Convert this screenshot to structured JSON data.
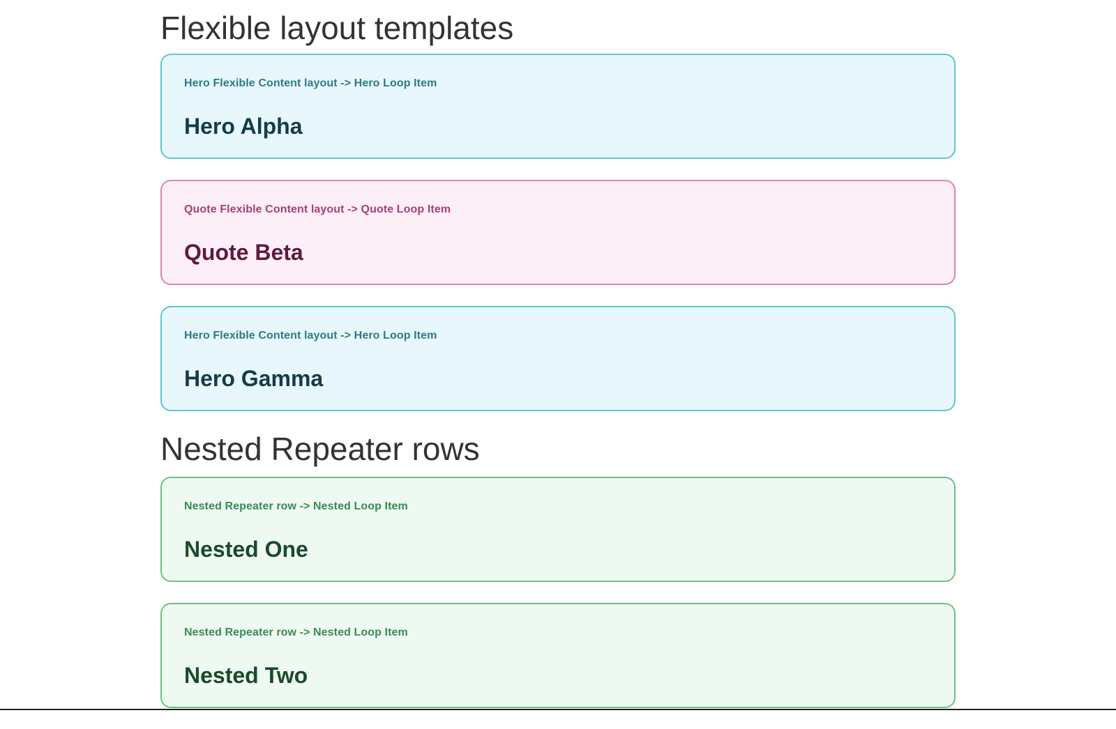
{
  "flexible": {
    "heading": "Flexible layout templates",
    "cards": [
      {
        "kicker": "Hero Flexible Content layout -> Hero Loop Item",
        "title": "Hero Alpha",
        "variant": "hero"
      },
      {
        "kicker": "Quote Flexible Content layout -> Quote Loop Item",
        "title": "Quote Beta",
        "variant": "quote"
      },
      {
        "kicker": "Hero Flexible Content layout -> Hero Loop Item",
        "title": "Hero Gamma",
        "variant": "hero"
      }
    ]
  },
  "nested": {
    "heading": "Nested Repeater rows",
    "cards": [
      {
        "kicker": "Nested Repeater row -> Nested Loop Item",
        "title": "Nested One",
        "variant": "nested"
      },
      {
        "kicker": "Nested Repeater row -> Nested Loop Item",
        "title": "Nested Two",
        "variant": "nested"
      }
    ]
  },
  "colors": {
    "hero_bg": "#e8f7fc",
    "hero_border": "#5ec7cb",
    "quote_bg": "#fdeff7",
    "quote_border": "#d884b4",
    "nested_bg": "#eef9f1",
    "nested_border": "#6fbf86"
  }
}
